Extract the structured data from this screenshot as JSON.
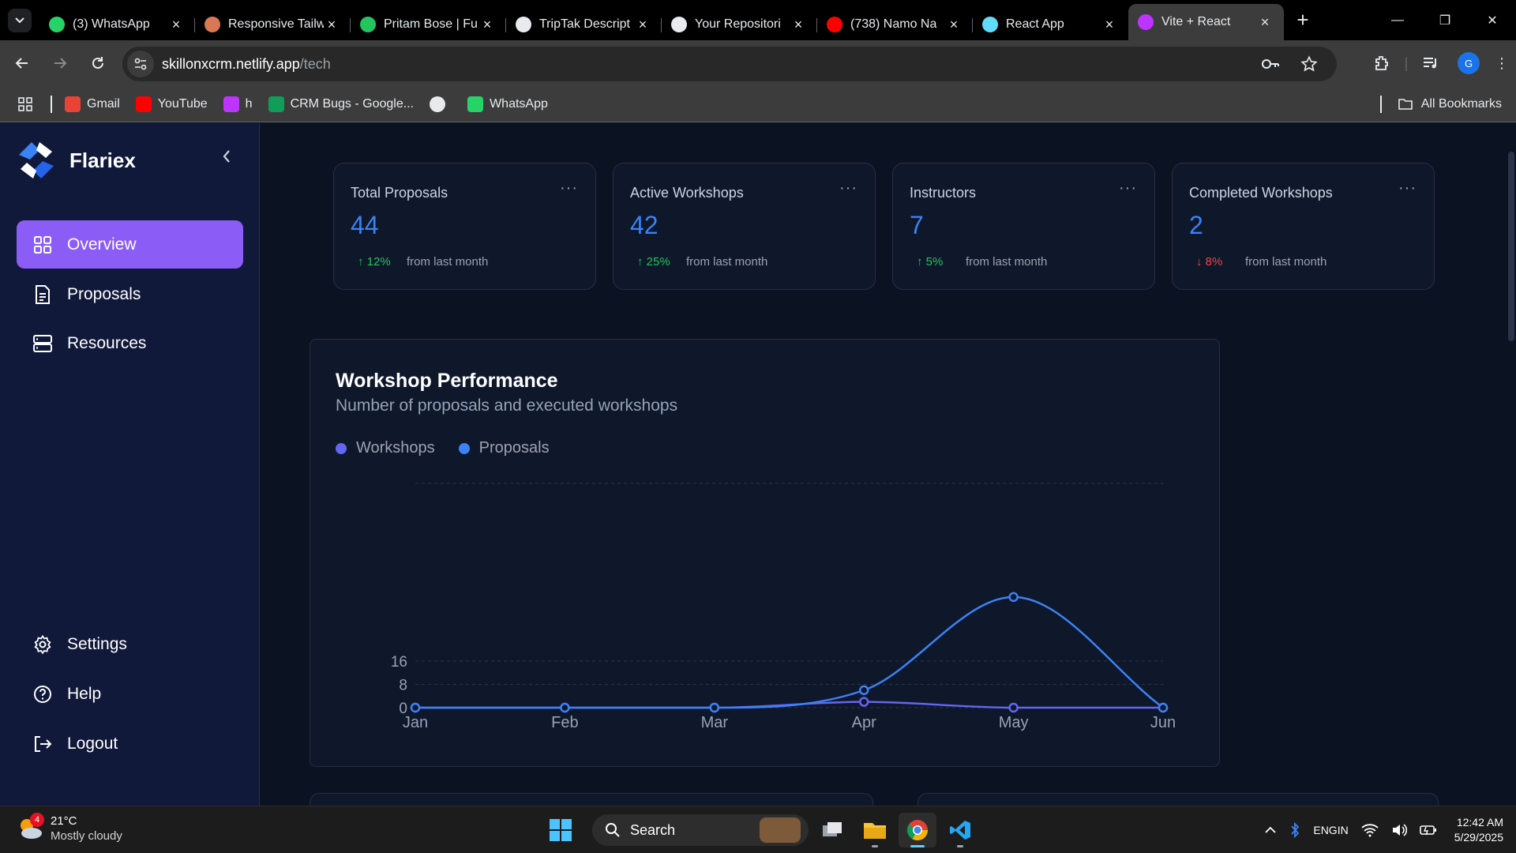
{
  "browser": {
    "tabs": [
      {
        "title": "(3) WhatsApp",
        "icon": "whatsapp-icon",
        "color": "#25d366"
      },
      {
        "title": "Responsive Tailw",
        "icon": "claude-icon",
        "color": "#d97757"
      },
      {
        "title": "Pritam Bose | Fu",
        "icon": "p-icon",
        "color": "#22c55e"
      },
      {
        "title": "TripTak Descript",
        "icon": "openai-icon",
        "color": "#e8eaed"
      },
      {
        "title": "Your Repositori",
        "icon": "github-icon",
        "color": "#e8eaed"
      },
      {
        "title": "(738) Namo Na",
        "icon": "youtube-icon",
        "color": "#ff0000"
      },
      {
        "title": "React App",
        "icon": "react-icon",
        "color": "#61dafb"
      },
      {
        "title": "Vite + React",
        "icon": "vite-icon",
        "color": "#bd34fe"
      }
    ],
    "url_host": "skillonxcrm.netlify.app",
    "url_path": "/tech",
    "profile_initial": "G",
    "bookmarks": [
      {
        "label": "Gmail",
        "icon": "gmail-icon",
        "color": "#ea4335"
      },
      {
        "label": "YouTube",
        "icon": "youtube-icon",
        "color": "#ff0000"
      },
      {
        "label": "h",
        "icon": "vite-icon",
        "color": "#bd34fe"
      },
      {
        "label": "CRM Bugs - Google...",
        "icon": "sheets-icon",
        "color": "#0f9d58"
      },
      {
        "label": "",
        "icon": "globe-icon",
        "color": "#e8eaed"
      },
      {
        "label": "WhatsApp",
        "icon": "whatsapp-icon",
        "color": "#25d366"
      }
    ],
    "all_bookmarks": "All Bookmarks"
  },
  "sidebar": {
    "brand": "Flariex",
    "items": [
      {
        "label": "Overview",
        "icon": "grid-icon",
        "active": true
      },
      {
        "label": "Proposals",
        "icon": "document-icon",
        "active": false
      },
      {
        "label": "Resources",
        "icon": "server-icon",
        "active": false
      }
    ],
    "bottom_items": [
      {
        "label": "Settings",
        "icon": "gear-icon"
      },
      {
        "label": "Help",
        "icon": "help-icon"
      },
      {
        "label": "Logout",
        "icon": "logout-icon"
      }
    ]
  },
  "stats": [
    {
      "title": "Total Proposals",
      "value": "44",
      "delta": "↑ 12%",
      "delta_dir": "up",
      "suffix": "from last month"
    },
    {
      "title": "Active Workshops",
      "value": "42",
      "delta": "↑ 25%",
      "delta_dir": "up",
      "suffix": "from last month"
    },
    {
      "title": "Instructors",
      "value": "7",
      "delta": "↑ 5%",
      "delta_dir": "up",
      "suffix": "from last month"
    },
    {
      "title": "Completed Workshops",
      "value": "2",
      "delta": "↓ 8%",
      "delta_dir": "down",
      "suffix": "from last month"
    }
  ],
  "chart_data": {
    "type": "line",
    "title": "Workshop Performance",
    "subtitle": "Number of proposals and executed workshops",
    "categories": [
      "Jan",
      "Feb",
      "Mar",
      "Apr",
      "May",
      "Jun"
    ],
    "yticks": [
      0,
      8,
      16
    ],
    "ylim": [
      0,
      40
    ],
    "smooth": true,
    "grid": true,
    "legend_position": "top-left",
    "series": [
      {
        "name": "Workshops",
        "color": "#6366f1",
        "values": [
          0,
          0,
          0,
          2,
          0,
          0
        ]
      },
      {
        "name": "Proposals",
        "color": "#3b82f6",
        "values": [
          0,
          0,
          0,
          6,
          38,
          0
        ]
      }
    ]
  },
  "taskbar": {
    "weather_badge": "4",
    "temperature": "21°C",
    "condition": "Mostly cloudy",
    "search_label": "Search",
    "lang_top": "ENG",
    "lang_bottom": "IN",
    "time": "12:42 AM",
    "date": "5/29/2025"
  }
}
